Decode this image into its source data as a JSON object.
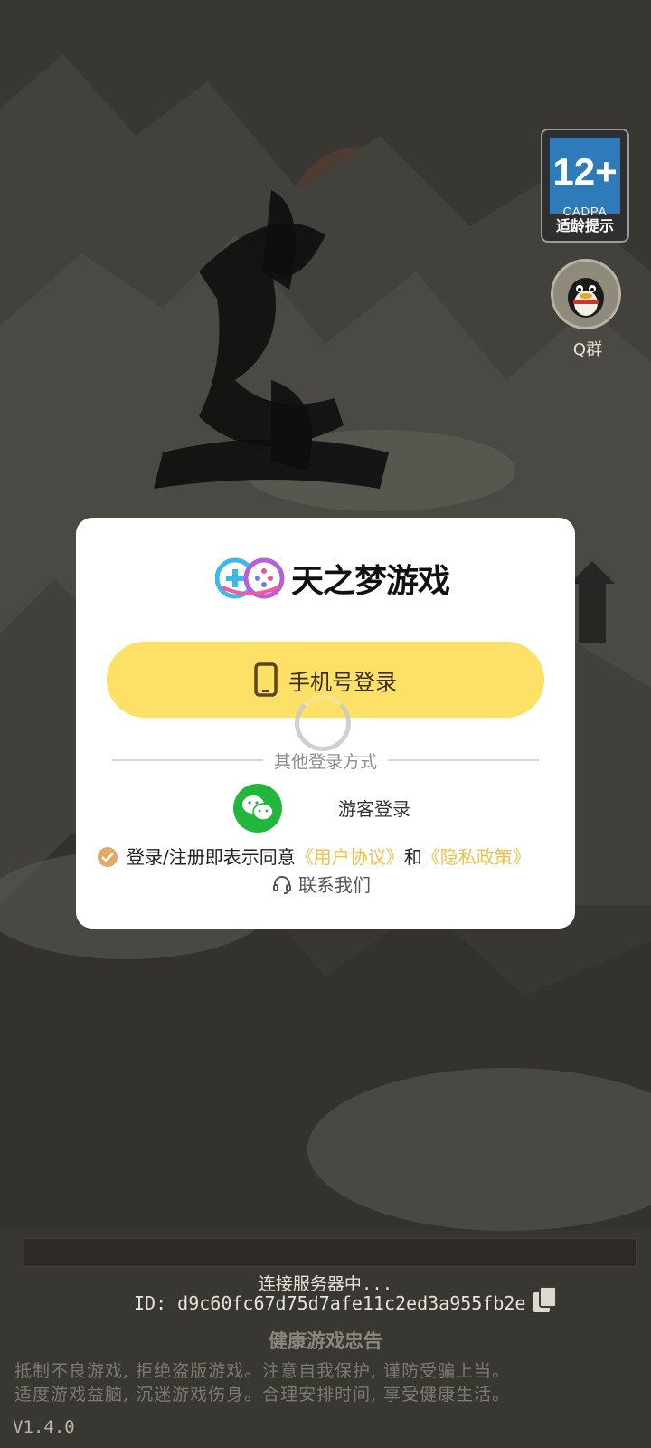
{
  "badge": {
    "age": "12+",
    "org": "CADPA",
    "label": "适龄提示"
  },
  "qq_group": {
    "label": "Q群"
  },
  "modal": {
    "brand": "天之梦游戏",
    "phone_login": "手机号登录",
    "divider_text": "其他登录方式",
    "guest_login": "游客登录",
    "agreement_prefix": "登录/注册即表示同意",
    "user_agreement": "《用户协议》",
    "and_text": "和",
    "privacy_policy": "《隐私政策》",
    "contact": "联系我们"
  },
  "footer": {
    "status": "连接服务器中...",
    "device_id": "ID: d9c60fc67d75d7afe11c2ed3a955fb2e",
    "health_title": "健康游戏忠告",
    "health_line1": "抵制不良游戏, 拒绝盗版游戏。注意自我保护, 谨防受骗上当。",
    "health_line2": "适度游戏益脑, 沉迷游戏伤身。合理安排时间, 享受健康生活。",
    "version": "V1.4.0"
  },
  "colors": {
    "accent": "#fde167",
    "link": "#f2c14a",
    "wechat": "#22b73c",
    "check": "#e4a866"
  }
}
